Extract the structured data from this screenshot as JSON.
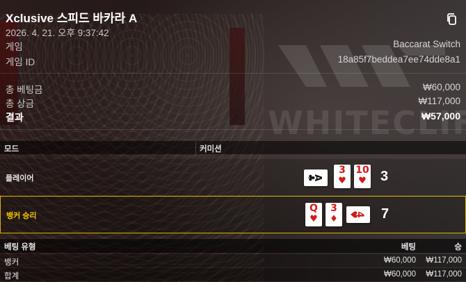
{
  "header": {
    "title": "Xclusive 스피드 바카라 A",
    "datetime": "2026. 4. 21. 오후 9:37:42",
    "copy_icon": "copy-icon"
  },
  "info": {
    "game_label": "게임",
    "game_value": "Baccarat Switch",
    "game_id_label": "게임 ID",
    "game_id_value": "18a85f7beddea7ee74dde8a1"
  },
  "totals": {
    "bet_label": "총 베팅금",
    "bet_value": "₩60,000",
    "payout_label": "총 상금",
    "payout_value": "₩117,000",
    "result_label": "결과",
    "result_value": "₩57,000"
  },
  "mode_header": {
    "mode_label": "모드",
    "commission_label": "커미션"
  },
  "hands": {
    "player": {
      "label": "플레이어",
      "score": "3",
      "cards": [
        {
          "rank": "A",
          "suit": "♣",
          "color": "black",
          "sideways": true
        },
        {
          "rank": "3",
          "suit": "♥",
          "color": "red",
          "sideways": false
        },
        {
          "rank": "10",
          "suit": "♥",
          "color": "red",
          "sideways": false
        }
      ]
    },
    "banker": {
      "label": "뱅커 승리",
      "score": "7",
      "cards": [
        {
          "rank": "Q",
          "suit": "♥",
          "color": "red",
          "sideways": false
        },
        {
          "rank": "3",
          "suit": "♦",
          "color": "red",
          "sideways": false
        },
        {
          "rank": "4",
          "suit": "♥",
          "color": "red",
          "sideways": true
        }
      ]
    }
  },
  "bets": {
    "headers": {
      "type": "베팅 유형",
      "bet": "베팅",
      "win": "승"
    },
    "rows": [
      {
        "type": "뱅커",
        "bet": "₩60,000",
        "win": "₩117,000"
      },
      {
        "type": "합계",
        "bet": "₩60,000",
        "win": "₩117,000"
      }
    ]
  },
  "background": {
    "watermark": "WHITECLIFF"
  },
  "colors": {
    "winner_border": "#d8b300",
    "winner_text": "#f2c300",
    "card_red": "#d11a1a"
  }
}
